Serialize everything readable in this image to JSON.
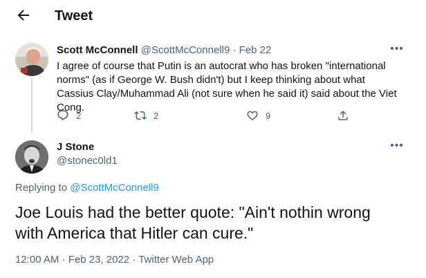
{
  "header": {
    "title": "Tweet",
    "back_icon": "back-arrow-icon"
  },
  "parent_tweet": {
    "name": "Scott McConnell",
    "handle": "@ScottMcConnell9",
    "separator": "·",
    "date": "Feb 22",
    "text": "I agree of course that Putin is an autocrat who has broken \"international norms\" (as if George W. Bush didn't) but I keep thinking about what Cassius Clay/Muhammad Ali (not sure when he said it) said about the Viet Cong.",
    "actions": {
      "reply_count": "2",
      "retweet_count": "2",
      "like_count": "9"
    }
  },
  "reply_tweet": {
    "name": "J Stone",
    "handle": "@stonec0ld1",
    "replying_prefix": "Replying to ",
    "replying_to": "@ScottMcConnell9",
    "text": "Joe Louis had the better quote: \"Ain't nothin wrong with America that Hitler can cure.\"",
    "time": "12:00 AM",
    "sep1": " · ",
    "date": "Feb 23, 2022",
    "sep2": " · ",
    "source": "Twitter Web App"
  },
  "colors": {
    "accent": "#1d9bf0",
    "secondary_text": "#536471",
    "primary_text": "#0f1419",
    "thread_line": "#cfd9de"
  }
}
